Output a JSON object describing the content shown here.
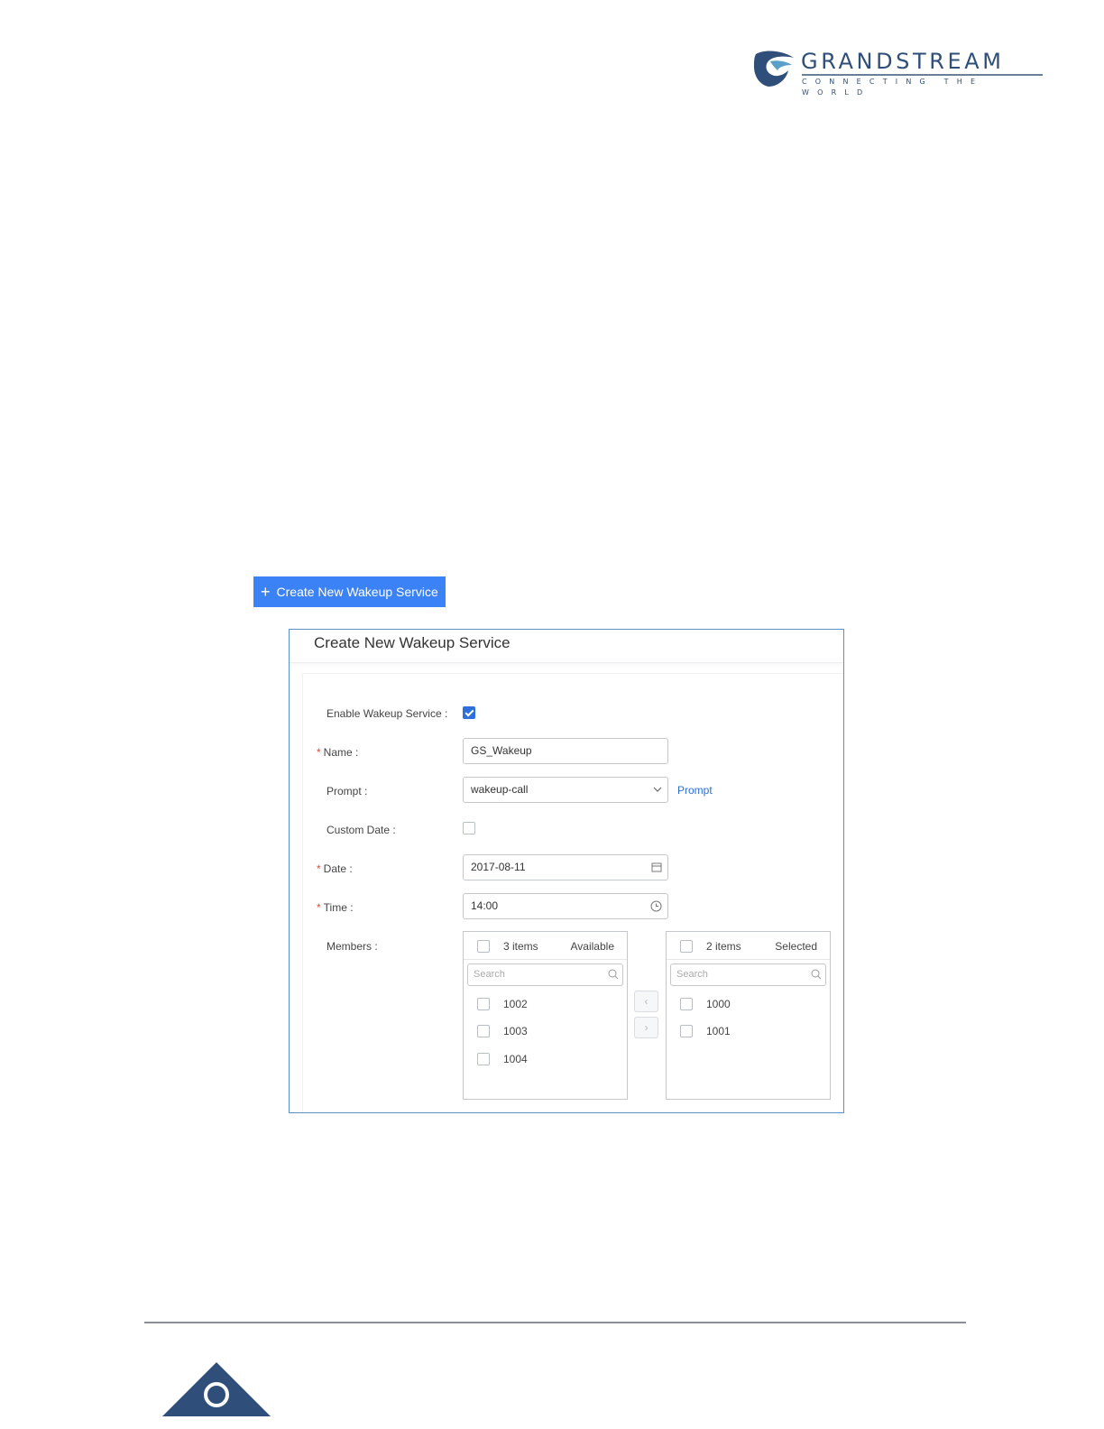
{
  "header": {
    "brand": "GRANDSTREAM",
    "tagline": "CONNECTING THE WORLD",
    "logo_icon": "grandstream-logo-icon",
    "colors": {
      "brand": "#2f4f7a"
    }
  },
  "create_button": {
    "icon": "plus-icon",
    "label": "Create New Wakeup Service",
    "color": "#3b82f6"
  },
  "dialog": {
    "title": "Create New Wakeup Service",
    "fields": {
      "enable": {
        "label": "Enable Wakeup Service :",
        "checked": true
      },
      "name": {
        "label": "Name :",
        "required": true,
        "value": "GS_Wakeup"
      },
      "prompt": {
        "label": "Prompt :",
        "value": "wakeup-call",
        "link": "Prompt"
      },
      "custom_date": {
        "label": "Custom Date :",
        "checked": false
      },
      "date": {
        "label": "Date :",
        "required": true,
        "value": "2017-08-11"
      },
      "time": {
        "label": "Time :",
        "required": true,
        "value": "14:00"
      },
      "members": {
        "label": "Members :"
      }
    },
    "transfer": {
      "available": {
        "count_label": "3 items",
        "title": "Available",
        "search_placeholder": "Search",
        "items": [
          "1002",
          "1003",
          "1004"
        ]
      },
      "selected": {
        "count_label": "2 items",
        "title": "Selected",
        "search_placeholder": "Search",
        "items": [
          "1000",
          "1001"
        ]
      }
    },
    "colors": {
      "border": "#5b8fc9",
      "required": "#e24b3b",
      "link": "#2c6fce",
      "checkbox": "#2f6fdc"
    }
  }
}
